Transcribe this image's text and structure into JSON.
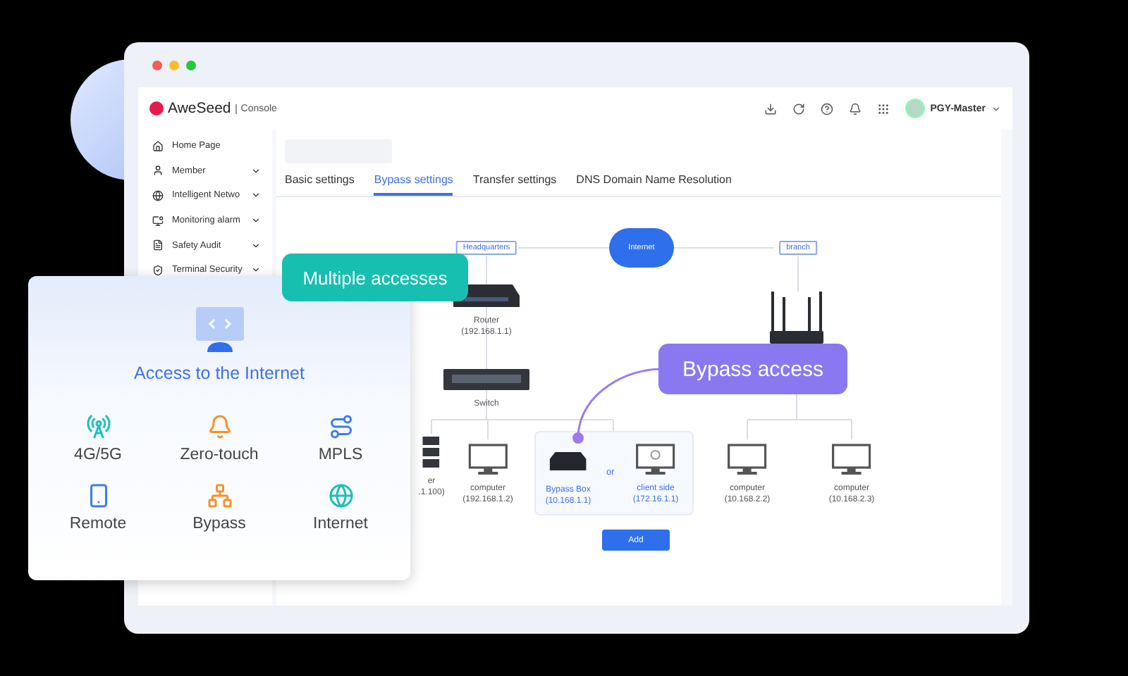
{
  "window": {
    "brand": "AweSeed",
    "product": "Console",
    "user": "PGY-Master"
  },
  "sidebar": {
    "items": [
      {
        "label": "Home Page",
        "has_submenu": false
      },
      {
        "label": "Member",
        "has_submenu": true
      },
      {
        "label": "Intelligent Netwo",
        "has_submenu": true
      },
      {
        "label": "Monitoring alarm",
        "has_submenu": true
      },
      {
        "label": "Safety Audit",
        "has_submenu": true
      },
      {
        "label": "Terminal Security",
        "has_submenu": true
      }
    ]
  },
  "tabs": [
    {
      "label": "Basic settings",
      "selected": false
    },
    {
      "label": "Bypass settings",
      "selected": true
    },
    {
      "label": "Transfer settings",
      "selected": false
    },
    {
      "label": "DNS Domain Name Resolution",
      "selected": false
    }
  ],
  "diagram": {
    "headquarters": "Headquarters",
    "cloud": "Internet",
    "branch": "branch",
    "nodes": [
      {
        "kind": "router",
        "name": "Router",
        "ip": "(192.168.1.1)"
      },
      {
        "kind": "switch",
        "name": "Switch"
      },
      {
        "kind": "wifi-router"
      },
      {
        "kind": "server",
        "name": "er",
        "ip": ".1.100)"
      },
      {
        "kind": "computer",
        "name": "computer",
        "ip": "(192.168.1.2)"
      },
      {
        "kind": "bypass-box",
        "name": "Bypass Box",
        "ip": "(10.168.1.1)"
      },
      {
        "kind": "client",
        "name": "client side",
        "ip": "(172.16.1.1)"
      },
      {
        "kind": "computer",
        "name": "computer",
        "ip": "(10.168.2.2)"
      },
      {
        "kind": "computer",
        "name": "computer",
        "ip": "(10.168.2.3)"
      }
    ],
    "or": "or",
    "add_button": "Add"
  },
  "callouts": {
    "multiple": "Multiple accesses",
    "bypass": "Bypass access"
  },
  "access_card": {
    "title": "Access to the Internet",
    "features": [
      {
        "kind": "cellular",
        "label": "4G/5G",
        "color": "#1cc0b5"
      },
      {
        "kind": "zero-touch",
        "label": "Zero-touch",
        "color": "#f5922b"
      },
      {
        "kind": "mpls",
        "label": "MPLS",
        "color": "#3d7bf0"
      },
      {
        "kind": "remote",
        "label": "Remote",
        "color": "#3d7bf0"
      },
      {
        "kind": "bypass",
        "label": "Bypass",
        "color": "#f5922b"
      },
      {
        "kind": "internet",
        "label": "Internet",
        "color": "#1cc0b5"
      }
    ]
  }
}
